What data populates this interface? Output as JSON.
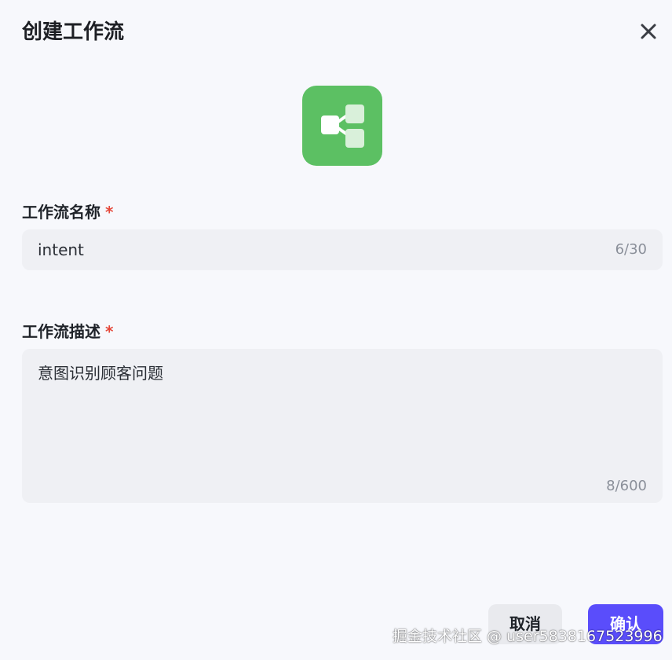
{
  "dialog": {
    "title": "创建工作流",
    "close_icon": "close-icon",
    "logo_icon": "workflow-icon",
    "accent_color": "#5cc063"
  },
  "name_field": {
    "label": "工作流名称",
    "required_mark": "*",
    "value": "intent",
    "counter": "6/30"
  },
  "description_field": {
    "label": "工作流描述",
    "required_mark": "*",
    "value": "意图识别顾客问题",
    "counter": "8/600"
  },
  "footer": {
    "cancel_label": "取消",
    "confirm_label": "确认",
    "confirm_color": "#5a4dfb"
  },
  "watermark": "掘金技术社区 @ user5838167523996"
}
